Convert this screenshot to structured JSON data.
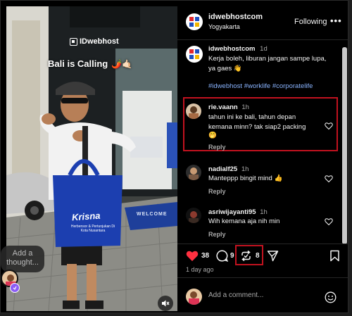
{
  "post": {
    "watermark": "IDwebhost",
    "overlay_text": "Bali is Calling",
    "overlay_emoji": "🌶️🤙🏻",
    "bag_brand": "Krisna",
    "bag_subtext": "Herbensor & Pertunjukan Di Kota Nusantara",
    "floor_mat_text": "WELCOME",
    "thought_placeholder": "Add a thought..."
  },
  "header": {
    "username": "idwebhostcom",
    "location": "Yogyakarta",
    "follow_label": "Following",
    "more_label": "•••"
  },
  "caption": {
    "username": "idwebhostcom",
    "time": "1d",
    "text_line1": "Kerja boleh, liburan jangan sampe lupa,",
    "text_line2": "ya gaes 👋",
    "hashtags": "#idwebhost #worklife #corporatelife"
  },
  "comments": [
    {
      "username": "rie.vaann",
      "time": "1h",
      "line1": "tahun ini ke bali, tahun depan",
      "line2": "kemana minn? tak siap2 packing",
      "line3": "🤭",
      "reply": "Reply"
    },
    {
      "username": "nadialf25",
      "time": "1h",
      "line1": "Manteppp bingit mind 👍",
      "reply": "Reply"
    },
    {
      "username": "asriwijayanti95",
      "time": "1h",
      "line1": "Wih kemana aja nih min",
      "reply": "Reply"
    }
  ],
  "actions": {
    "likes": "38",
    "comments": "9",
    "reposts": "8",
    "time_ago": "1 day ago"
  },
  "add_comment": {
    "placeholder": "Add a comment..."
  },
  "colors": {
    "like_red": "#ff3040",
    "highlight": "#c1121f",
    "hashtag": "#8ab4ff",
    "bag_blue": "#1c3fb0"
  }
}
